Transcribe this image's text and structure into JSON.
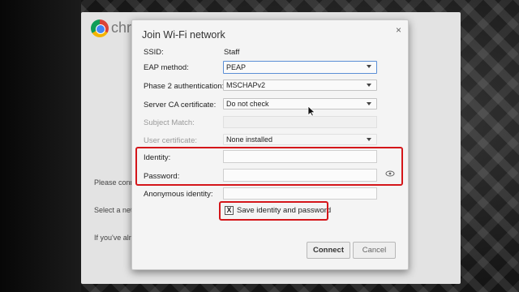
{
  "background_page": {
    "brand": "chr",
    "line1": "Please conn",
    "line2": "Select a netw",
    "line3": "If you've alre"
  },
  "dialog": {
    "title": "Join Wi-Fi network",
    "close": "×",
    "fields": {
      "ssid_label": "SSID:",
      "ssid_value": "Staff",
      "eap_label": "EAP method:",
      "eap_value": "PEAP",
      "phase2_label": "Phase 2 authentication:",
      "phase2_value": "MSCHAPv2",
      "ca_label": "Server CA certificate:",
      "ca_value": "Do not check",
      "subject_label": "Subject Match:",
      "subject_value": "",
      "usercert_label": "User certificate:",
      "usercert_value": "None installed",
      "identity_label": "Identity:",
      "identity_value": "",
      "password_label": "Password:",
      "password_value": "",
      "anon_label": "Anonymous identity:",
      "anon_value": ""
    },
    "save_checkbox": {
      "checked": true,
      "mark": "X",
      "label": "Save identity and password"
    },
    "buttons": {
      "connect": "Connect",
      "cancel": "Cancel"
    }
  },
  "colors": {
    "highlight": "#d4161a",
    "dialog_bg": "#f4f4f4",
    "focus_border": "#5b8fd6"
  },
  "icons": [
    "chrome-logo-icon",
    "close-icon",
    "dropdown-arrow-icon",
    "show-password-eye-icon",
    "mouse-cursor-icon"
  ]
}
